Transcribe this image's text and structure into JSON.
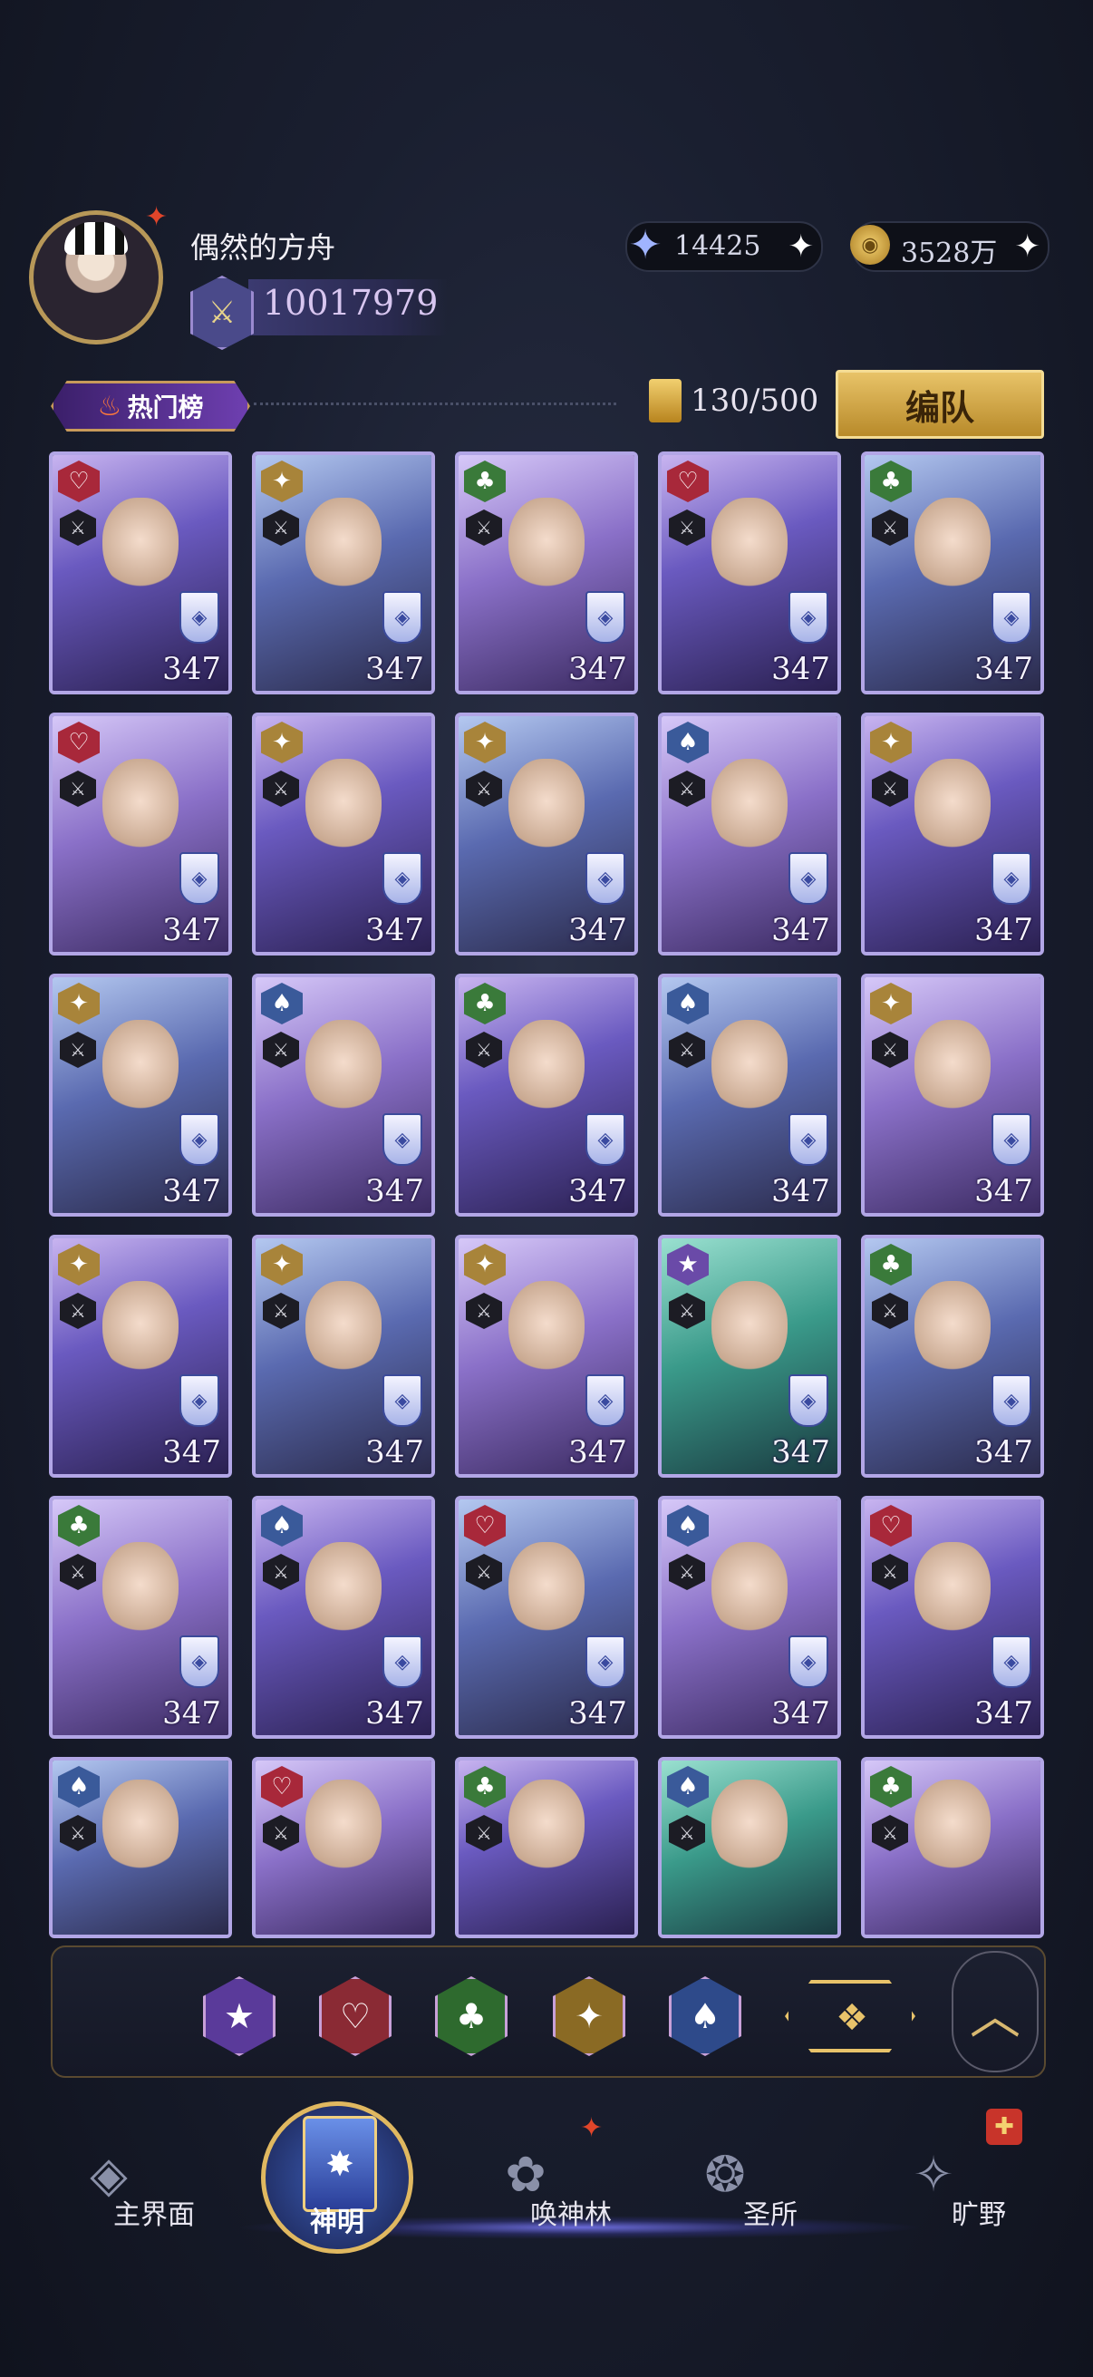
{
  "player": {
    "name": "偶然的方舟",
    "power": "10017979"
  },
  "resources": {
    "gems": "14425",
    "gold": "3528万"
  },
  "toolbar": {
    "hot_label": "热门榜",
    "count": "130/500",
    "team_button": "编队"
  },
  "cards": [
    {
      "suit": "heart",
      "level": "347"
    },
    {
      "suit": "diamond",
      "level": "347"
    },
    {
      "suit": "club",
      "level": "347"
    },
    {
      "suit": "heart",
      "level": "347"
    },
    {
      "suit": "club",
      "level": "347"
    },
    {
      "suit": "heart",
      "level": "347"
    },
    {
      "suit": "diamond",
      "level": "347"
    },
    {
      "suit": "diamond",
      "level": "347"
    },
    {
      "suit": "spade",
      "level": "347"
    },
    {
      "suit": "diamond",
      "level": "347"
    },
    {
      "suit": "diamond",
      "level": "347"
    },
    {
      "suit": "spade",
      "level": "347"
    },
    {
      "suit": "club",
      "level": "347"
    },
    {
      "suit": "spade",
      "level": "347"
    },
    {
      "suit": "diamond",
      "level": "347"
    },
    {
      "suit": "diamond",
      "level": "347"
    },
    {
      "suit": "diamond",
      "level": "347"
    },
    {
      "suit": "diamond",
      "level": "347"
    },
    {
      "suit": "star",
      "level": "347"
    },
    {
      "suit": "club",
      "level": "347"
    },
    {
      "suit": "club",
      "level": "347"
    },
    {
      "suit": "spade",
      "level": "347"
    },
    {
      "suit": "heart",
      "level": "347"
    },
    {
      "suit": "spade",
      "level": "347"
    },
    {
      "suit": "heart",
      "level": "347"
    },
    {
      "suit": "spade",
      "level": ""
    },
    {
      "suit": "heart",
      "level": ""
    },
    {
      "suit": "club",
      "level": ""
    },
    {
      "suit": "spade",
      "level": ""
    },
    {
      "suit": "club",
      "level": ""
    }
  ],
  "suit_colors": {
    "heart": "#a8283a",
    "diamond": "#a8843a",
    "club": "#3a7a3a",
    "spade": "#3a5a9a",
    "star": "#6a4aa8"
  },
  "suit_glyphs": {
    "heart": "♡",
    "diamond": "✦",
    "club": "♣",
    "spade": "♠",
    "star": "★"
  },
  "filters": [
    {
      "name": "star",
      "glyph": "★",
      "color": "#5a3a9a"
    },
    {
      "name": "heart",
      "glyph": "♡",
      "color": "#8a2a34"
    },
    {
      "name": "club",
      "glyph": "♣",
      "color": "#2e6a2e"
    },
    {
      "name": "diamond",
      "glyph": "✦",
      "color": "#8a6a24"
    },
    {
      "name": "spade",
      "glyph": "♠",
      "color": "#2e4a8a"
    }
  ],
  "nav": [
    {
      "label": "主界面",
      "icon": "home-icon"
    },
    {
      "label": "神明",
      "icon": "deity-book-icon"
    },
    {
      "label": "唤神林",
      "icon": "tree-icon"
    },
    {
      "label": "圣所",
      "icon": "sanctuary-icon"
    },
    {
      "label": "旷野",
      "icon": "compass-icon"
    }
  ]
}
